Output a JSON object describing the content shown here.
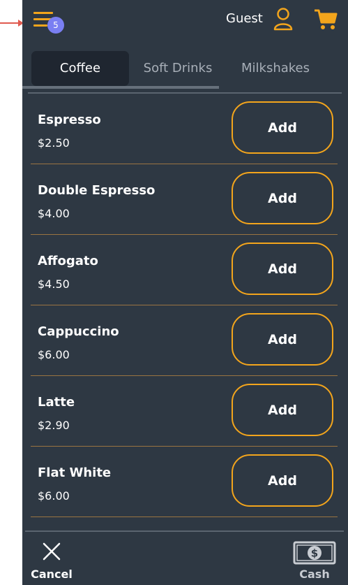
{
  "header": {
    "menu_badge": "5",
    "guest_label": "Guest"
  },
  "tabs": [
    {
      "label": "Coffee",
      "active": true
    },
    {
      "label": "Soft Drinks",
      "active": false
    },
    {
      "label": "Milkshakes",
      "active": false
    }
  ],
  "items": [
    {
      "name": "Espresso",
      "price": "$2.50",
      "button": "Add"
    },
    {
      "name": "Double Espresso",
      "price": "$4.00",
      "button": "Add"
    },
    {
      "name": "Affogato",
      "price": "$4.50",
      "button": "Add"
    },
    {
      "name": "Cappuccino",
      "price": "$6.00",
      "button": "Add"
    },
    {
      "name": "Latte",
      "price": "$2.90",
      "button": "Add"
    },
    {
      "name": "Flat White",
      "price": "$6.00",
      "button": "Add"
    }
  ],
  "footer": {
    "cancel_label": "Cancel",
    "cash_label": "Cash"
  },
  "icons": {
    "menu": "hamburger-icon",
    "user": "user-icon",
    "cart": "cart-icon",
    "cancel": "close-icon",
    "cash": "cash-icon",
    "annotation": "arrow-icon"
  },
  "colors": {
    "background": "#2e3843",
    "accent": "#f3a51c",
    "badge": "#7a7ff2",
    "active_tab": "#1f2630",
    "annotation_arrow": "#e05a4f"
  }
}
